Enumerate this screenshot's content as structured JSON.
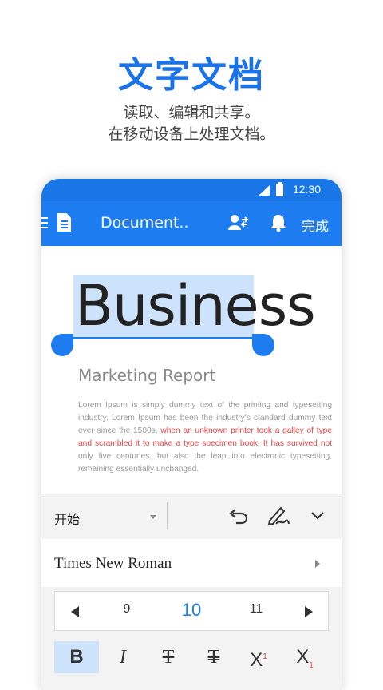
{
  "promo": {
    "headline": "文字文档",
    "subline1": "读取、编辑和共享。",
    "subline2": "在移动设备上处理文档。"
  },
  "status_bar": {
    "time": "12:30"
  },
  "app_bar": {
    "title": "Document..",
    "done_label": "完成",
    "accent_color": "#1c7cf0"
  },
  "document": {
    "heading": "Business",
    "selected_part": "Busine",
    "subtitle": "Marketing Report",
    "body_part1": "Lorem Ipsum is simply dummy text of the printing and typesetting industry. Lorem Ipsum has been the industry's standard dummy text ever since the 1500s, ",
    "body_red": "when an unknown printer took a galley of type and scrambled it to make a type specimen book. It has survived not",
    "body_part2": " only five centuries, but also the leap into electronic typesetting, remaining essentially unchanged.",
    "red_color": "#e84545"
  },
  "toolbar": {
    "tab_label": "开始"
  },
  "format_panel": {
    "font_name": "Times New Roman",
    "sizes": {
      "prev": "9",
      "current": "10",
      "next": "11"
    },
    "buttons": {
      "bold": "B",
      "italic": "I",
      "strike": "T",
      "double_strike": "T",
      "superscript": "X",
      "superscript_mark": "1",
      "subscript": "X",
      "subscript_mark": "1"
    }
  }
}
